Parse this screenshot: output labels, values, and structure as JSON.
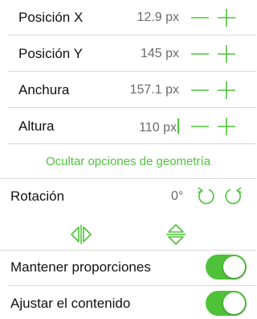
{
  "accent_color": "#4fc23a",
  "geometry": {
    "rows": [
      {
        "label": "Posición X",
        "value": "12.9 px"
      },
      {
        "label": "Posición Y",
        "value": "145 px"
      },
      {
        "label": "Anchura",
        "value": "157.1 px"
      },
      {
        "label": "Altura",
        "value": "110 px"
      }
    ],
    "toggle_link": "Ocultar opciones de geometría"
  },
  "rotation": {
    "label": "Rotación",
    "value": "0°"
  },
  "options": {
    "keep_proportions": {
      "label": "Mantener proporciones",
      "on": true
    },
    "fit_content": {
      "label": "Ajustar el contenido",
      "on": true
    }
  },
  "icons": {
    "decrement": "minus-icon",
    "increment": "plus-icon",
    "rotate_left": "rotate-left-icon",
    "rotate_right": "rotate-right-icon",
    "flip_horizontal": "flip-horizontal-icon",
    "flip_vertical": "flip-vertical-icon"
  }
}
